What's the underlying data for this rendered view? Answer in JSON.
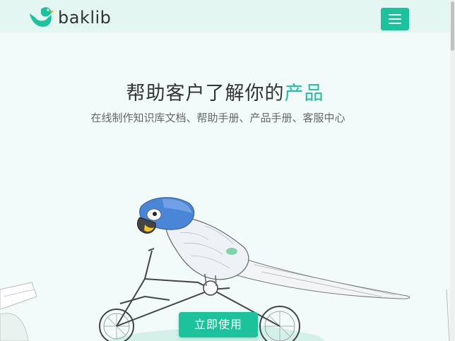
{
  "header": {
    "logo_text": "baklib",
    "menu_icon": "hamburger-menu-icon"
  },
  "hero": {
    "title_main": "帮助客户了解你的",
    "title_accent": "产品",
    "subtitle": "在线制作知识库文档、帮助手册、产品手册、客服中心",
    "cta_label": "立即使用"
  },
  "illustration": {
    "subject": "parrot-riding-bicycle-icon"
  },
  "colors": {
    "accent": "#1bc29c",
    "header_bg": "#e3f6f2",
    "page_bg": "#f2fbf9",
    "text_dark": "#333333",
    "text_muted": "#666666"
  }
}
